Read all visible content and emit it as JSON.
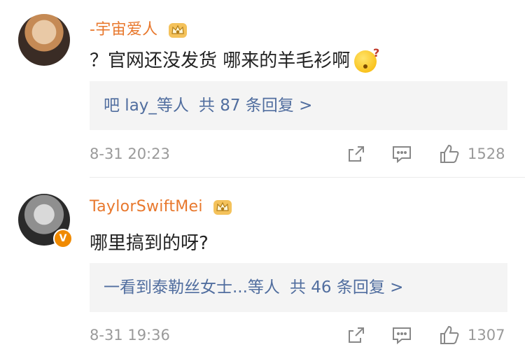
{
  "comments": [
    {
      "username": "-宇宙爱人",
      "text": "？官网还没发货 哪来的羊毛衫啊",
      "reply": {
        "users": "吧 lay_等人",
        "count": "共 87 条回复 >"
      },
      "time": "8-31 20:23",
      "likes": "1528"
    },
    {
      "username": "TaylorSwiftMei",
      "text": "哪里搞到的呀?",
      "reply": {
        "users": "一看到泰勒丝女士...等人",
        "count": "共 46 条回复 >"
      },
      "time": "8-31 19:36",
      "likes": "1307"
    }
  ],
  "colors": {
    "username": "#e8782d",
    "link": "#516e9f",
    "meta": "#9a9a9a",
    "verified": "#f08a00"
  },
  "icons": [
    "crown-icon",
    "emoji-icon",
    "verified-icon",
    "share-icon",
    "comment-icon",
    "like-icon"
  ]
}
